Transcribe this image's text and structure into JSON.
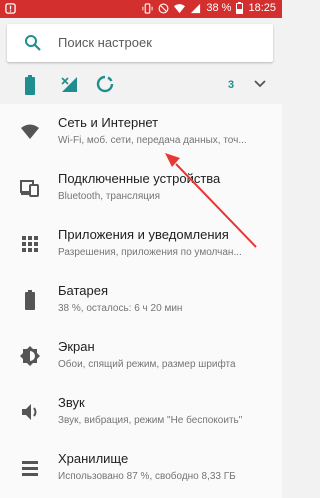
{
  "status_bar": {
    "battery_percent": "38 %",
    "time": "18:25",
    "accent": "#d32f2f"
  },
  "search": {
    "placeholder": "Поиск настроек",
    "icon": "search-icon"
  },
  "quick_settings": {
    "icons": [
      "battery-icon",
      "no-signal-icon",
      "data-saver-icon"
    ],
    "count": "3",
    "expand_icon": "chevron-down-icon"
  },
  "settings": {
    "items": [
      {
        "title": "Сеть и Интернет",
        "subtitle": "Wi-Fi, моб. сети, передача данных, точ...",
        "icon": "wifi-icon"
      },
      {
        "title": "Подключенные устройства",
        "subtitle": "Bluetooth, трансляция",
        "icon": "connected-devices-icon"
      },
      {
        "title": "Приложения и уведомления",
        "subtitle": "Разрешения, приложения по умолчан...",
        "icon": "apps-grid-icon"
      },
      {
        "title": "Батарея",
        "subtitle": "38 %, осталось: 6 ч 20 мин",
        "icon": "battery-icon"
      },
      {
        "title": "Экран",
        "subtitle": "Обои, спящий режим, размер шрифта",
        "icon": "brightness-icon"
      },
      {
        "title": "Звук",
        "subtitle": "Звук, вибрация, режим \"Не беспокоить\"",
        "icon": "volume-icon"
      },
      {
        "title": "Хранилище",
        "subtitle": "Использовано 87 %, свободно 8,33 ГБ",
        "icon": "storage-icon"
      }
    ]
  },
  "colors": {
    "teal": "#1e8e8e",
    "icon_gray": "#555555",
    "arrow": "#e53935"
  }
}
